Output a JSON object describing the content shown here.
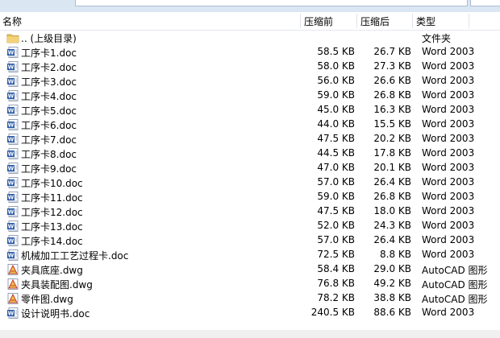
{
  "header": {
    "name": "名称",
    "size": "压缩前",
    "packed": "压缩后",
    "type": "类型"
  },
  "rows": [
    {
      "name": ".. (上级目录)",
      "size": "",
      "packed": "",
      "type": "文件夹",
      "icon": "folder-icon"
    },
    {
      "name": "工序卡1.doc",
      "size": "58.5 KB",
      "packed": "26.7 KB",
      "type": "Word 2003",
      "icon": "word-doc-icon"
    },
    {
      "name": "工序卡2.doc",
      "size": "58.0 KB",
      "packed": "27.3 KB",
      "type": "Word 2003",
      "icon": "word-doc-icon"
    },
    {
      "name": "工序卡3.doc",
      "size": "56.0 KB",
      "packed": "26.6 KB",
      "type": "Word 2003",
      "icon": "word-doc-icon"
    },
    {
      "name": "工序卡4.doc",
      "size": "59.0 KB",
      "packed": "26.8 KB",
      "type": "Word 2003",
      "icon": "word-doc-icon"
    },
    {
      "name": "工序卡5.doc",
      "size": "45.0 KB",
      "packed": "16.3 KB",
      "type": "Word 2003",
      "icon": "word-doc-icon"
    },
    {
      "name": "工序卡6.doc",
      "size": "44.0 KB",
      "packed": "15.5 KB",
      "type": "Word 2003",
      "icon": "word-doc-icon"
    },
    {
      "name": "工序卡7.doc",
      "size": "47.5 KB",
      "packed": "20.2 KB",
      "type": "Word 2003",
      "icon": "word-doc-icon"
    },
    {
      "name": "工序卡8.doc",
      "size": "44.5 KB",
      "packed": "17.8 KB",
      "type": "Word 2003",
      "icon": "word-doc-icon"
    },
    {
      "name": "工序卡9.doc",
      "size": "47.0 KB",
      "packed": "20.1 KB",
      "type": "Word 2003",
      "icon": "word-doc-icon"
    },
    {
      "name": "工序卡10.doc",
      "size": "57.0 KB",
      "packed": "26.4 KB",
      "type": "Word 2003",
      "icon": "word-doc-icon"
    },
    {
      "name": "工序卡11.doc",
      "size": "59.0 KB",
      "packed": "26.8 KB",
      "type": "Word 2003",
      "icon": "word-doc-icon"
    },
    {
      "name": "工序卡12.doc",
      "size": "47.5 KB",
      "packed": "18.0 KB",
      "type": "Word 2003",
      "icon": "word-doc-icon"
    },
    {
      "name": "工序卡13.doc",
      "size": "52.0 KB",
      "packed": "24.3 KB",
      "type": "Word 2003",
      "icon": "word-doc-icon"
    },
    {
      "name": "工序卡14.doc",
      "size": "57.0 KB",
      "packed": "26.4 KB",
      "type": "Word 2003",
      "icon": "word-doc-icon"
    },
    {
      "name": "机械加工工艺过程卡.doc",
      "size": "72.5 KB",
      "packed": "8.8 KB",
      "type": "Word 2003",
      "icon": "word-doc-icon"
    },
    {
      "name": "夹具底座.dwg",
      "size": "58.4 KB",
      "packed": "29.0 KB",
      "type": "AutoCAD 图形",
      "icon": "autocad-dwg-icon"
    },
    {
      "name": "夹具装配图.dwg",
      "size": "76.8 KB",
      "packed": "49.2 KB",
      "type": "AutoCAD 图形",
      "icon": "autocad-dwg-icon"
    },
    {
      "name": "零件图.dwg",
      "size": "78.2 KB",
      "packed": "38.8 KB",
      "type": "AutoCAD 图形",
      "icon": "autocad-dwg-icon"
    },
    {
      "name": "设计说明书.doc",
      "size": "240.5 KB",
      "packed": "88.6 KB",
      "type": "Word 2003",
      "icon": "word-doc-icon"
    }
  ],
  "colors": {
    "word_blue": "#2a5aa8",
    "folder_yellow": "#e8c15a",
    "autocad_red": "#c0392b"
  }
}
